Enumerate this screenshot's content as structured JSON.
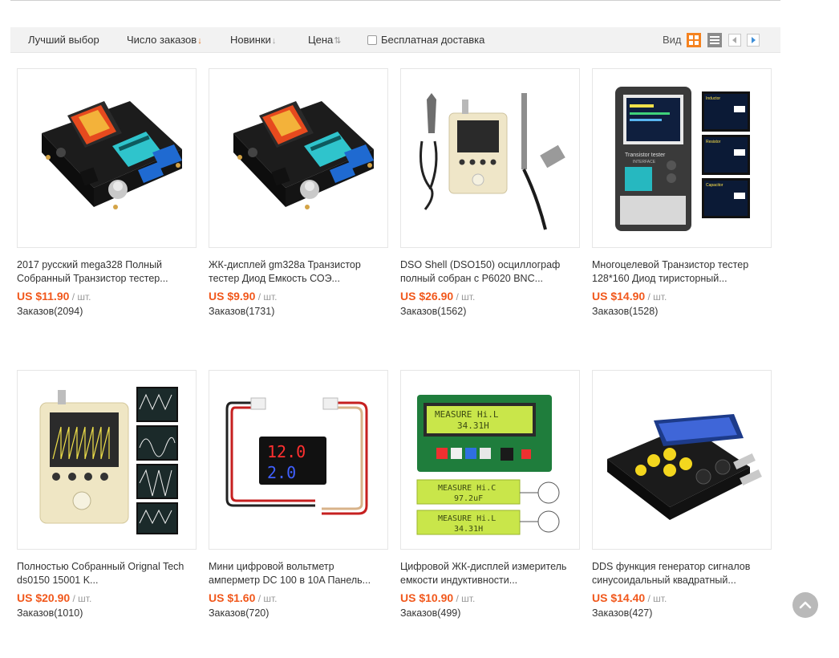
{
  "sortbar": {
    "items": [
      {
        "label": "Лучший выбор",
        "arrow": ""
      },
      {
        "label": "Число заказов",
        "arrow": "↓"
      },
      {
        "label": "Новинки",
        "arrow": "↓"
      },
      {
        "label": "Цена",
        "arrow": "⇅"
      }
    ],
    "free_shipping": "Бесплатная доставка",
    "view_label": "Вид"
  },
  "products": [
    {
      "title": "2017 русский mega328 Полный Собранный Транзистор тестер...",
      "price": "US $11.90",
      "unit": " / шт.",
      "orders": "Заказов(2094)",
      "icon": "transistor-tester-board-image"
    },
    {
      "title": "ЖК-дисплей gm328a Транзистор тестер Диод Емкость СОЭ...",
      "price": "US $9.90",
      "unit": " / шт.",
      "orders": "Заказов(1731)",
      "icon": "transistor-tester-board-image"
    },
    {
      "title": "DSO Shell (DSO150) осциллограф полный собран с P6020 BNC...",
      "price": "US $26.90",
      "unit": " / шт.",
      "orders": "Заказов(1562)",
      "icon": "oscilloscope-kit-image"
    },
    {
      "title": "Многоцелевой Транзистор тестер 128*160 Диод тиристорный...",
      "price": "US $14.90",
      "unit": " / шт.",
      "orders": "Заказов(1528)",
      "icon": "transistor-tester-image"
    },
    {
      "title": "Полностью Собранный Orignal Tech ds0150 15001 K...",
      "price": "US $20.90",
      "unit": " / шт.",
      "orders": "Заказов(1010)",
      "icon": "oscilloscope-image"
    },
    {
      "title": "Мини цифровой вольтметр амперметр DC 100 в 10A Панель...",
      "price": "US $1.60",
      "unit": " / шт.",
      "orders": "Заказов(720)",
      "icon": "volt-ampere-meter-image"
    },
    {
      "title": "Цифровой ЖК-дисплей измеритель емкости индуктивности...",
      "price": "US $10.90",
      "unit": " / шт.",
      "orders": "Заказов(499)",
      "icon": "lc-meter-image"
    },
    {
      "title": "DDS функция генератор сигналов синусоидальный квадратный...",
      "price": "US $14.40",
      "unit": " / шт.",
      "orders": "Заказов(427)",
      "icon": "signal-generator-image"
    }
  ],
  "images": {
    "meter_v": "12.0",
    "meter_a": "2.0",
    "lc_top": "MEASURE Hi.L",
    "lc_top2": "34.31H",
    "lc_mid": "MEASURE Hi.C",
    "lc_mid2": "97.2uF",
    "lc_bot": "MEASURE Hi.L",
    "lc_bot2": "34.31H",
    "tester_label": "Transistor tester",
    "tester_label2": "INTERFACE",
    "tester_panels": [
      "Inductor",
      "Resistor",
      "Capacitor"
    ]
  },
  "colors": {
    "accent": "#f5821f",
    "price": "#f1581c"
  }
}
